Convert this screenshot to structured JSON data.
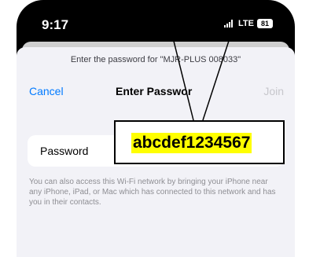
{
  "status_bar": {
    "time": "9:17",
    "network": "LTE",
    "battery": "81"
  },
  "sheet": {
    "prompt": "Enter the password for \"MJR-PLUS 008033\"",
    "cancel_label": "Cancel",
    "title": "Enter Passwor",
    "join_label": "Join",
    "password_label": "Password",
    "help_text": "You can also access this Wi-Fi network by bringing your iPhone near any iPhone, iPad, or Mac which has connected to this network and has you in their contacts."
  },
  "annotation": {
    "password_value": "abcdef1234567"
  }
}
